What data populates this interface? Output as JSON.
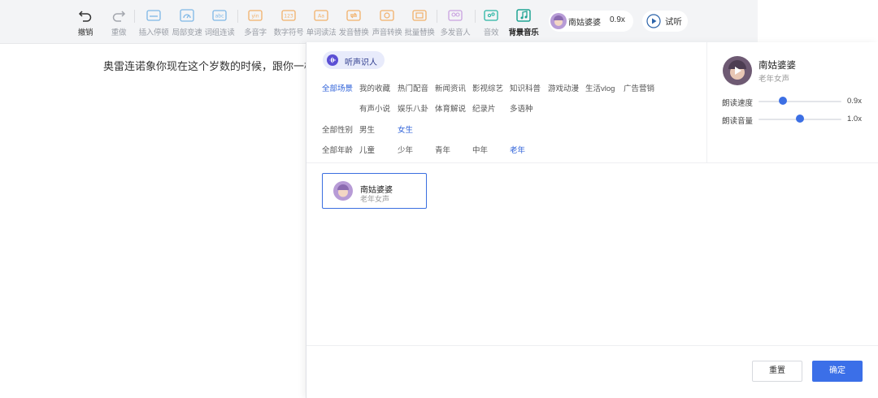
{
  "toolbar": {
    "undo": "撤销",
    "redo": "重做",
    "insert_pause": "插入停顿",
    "local_speed": "局部变速",
    "word_link": "词组连读",
    "polyphone": "多音字",
    "number_symbol": "数字符号",
    "word_reading": "单词读法",
    "pronunciation_replace": "发音替换",
    "voice_convert": "声音转换",
    "batch_replace": "批量替换",
    "multi_speaker": "多发音人",
    "sound_effect": "音效",
    "bg_music": "背景音乐",
    "voice_name": "南姑婆婆",
    "voice_speed": "0.9x",
    "preview": "试听"
  },
  "editor": {
    "text": "奥雷连诺象你现在这个岁数的时候，跟你一模"
  },
  "panel": {
    "voice_tag": "听声识人",
    "scene_label": "全部场景",
    "scenes_row1": [
      "我的收藏",
      "热门配音",
      "新闻资讯",
      "影视综艺",
      "知识科普",
      "游戏动漫",
      "生活vlog",
      "广告营销"
    ],
    "scenes_row2": [
      "有声小说",
      "娱乐八卦",
      "体育解说",
      "纪录片",
      "多语种"
    ],
    "gender_label": "全部性别",
    "genders": [
      "男生",
      "女生"
    ],
    "age_label": "全部年龄",
    "ages": [
      "儿童",
      "少年",
      "青年",
      "中年",
      "老年"
    ],
    "card": {
      "name": "南姑婆婆",
      "desc": "老年女声"
    },
    "selected": {
      "name": "南姑婆婆",
      "desc": "老年女声",
      "speed_label": "朗读速度",
      "speed_value": "0.9x",
      "speed_level": 0.29,
      "volume_label": "朗读音量",
      "volume_value": "1.0x",
      "volume_level": 0.5
    },
    "reset": "重置",
    "confirm": "确定"
  },
  "colors": {
    "accent": "#3b6fe8",
    "icon_blue": "#7eb7e6",
    "icon_orange": "#f2b06a",
    "icon_purple": "#c9a2e0",
    "icon_teal": "#2ab5a4"
  }
}
